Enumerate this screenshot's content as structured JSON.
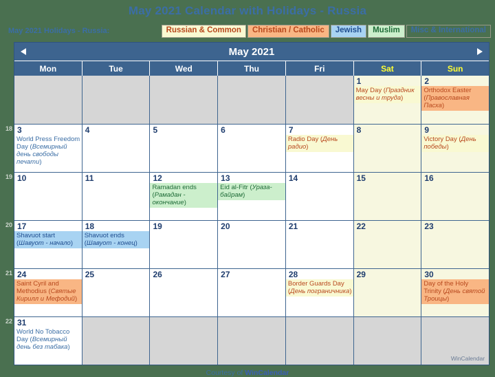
{
  "banner": {
    "title": "May 2021 Calendar with Holidays - Russia"
  },
  "legend": {
    "caption": "May 2021 Holidays - Russia:",
    "chips": [
      {
        "label": "Russian & Common",
        "bg": "#f9f9d2",
        "fg": "#b8481d"
      },
      {
        "label": "Christian / Catholic",
        "bg": "#f9b684",
        "fg": "#b8481d"
      },
      {
        "label": "Jewish",
        "bg": "#a8d3f2",
        "fg": "#1f4d8f"
      },
      {
        "label": "Muslim",
        "bg": "#ccefcc",
        "fg": "#1e6b37"
      },
      {
        "label": "Misc & International",
        "bg": "#4a7050",
        "fg": "#3b6ea5"
      }
    ]
  },
  "calendar": {
    "month_title": "May 2021",
    "prev_label": "◀",
    "next_label": "▶",
    "dow": [
      "Mon",
      "Tue",
      "Wed",
      "Thu",
      "Fri",
      "Sat",
      "Sun"
    ],
    "week_numbers": [
      "",
      "18",
      "19",
      "20",
      "21",
      "22"
    ],
    "weeks": [
      [
        {
          "num": "",
          "blank": true
        },
        {
          "num": "",
          "blank": true
        },
        {
          "num": "",
          "blank": true
        },
        {
          "num": "",
          "blank": true
        },
        {
          "num": "",
          "blank": true
        },
        {
          "num": "1",
          "weekend": true,
          "events": [
            {
              "cat": "russian",
              "en": "May Day (",
              "ru": "Праздник весны и труда",
              "close": ")"
            }
          ]
        },
        {
          "num": "2",
          "weekend": true,
          "events": [
            {
              "cat": "christian",
              "en": "Orthodox Easter (",
              "ru": "Православная Пасха",
              "close": ")"
            }
          ]
        }
      ],
      [
        {
          "num": "3",
          "events": [
            {
              "cat": "misc",
              "en": "World Press Freedom Day (",
              "ru": "Всемирный день свободы печати",
              "close": ")"
            }
          ]
        },
        {
          "num": "4",
          "events": []
        },
        {
          "num": "5",
          "events": []
        },
        {
          "num": "6",
          "events": []
        },
        {
          "num": "7",
          "events": [
            {
              "cat": "russian",
              "en": "Radio Day (",
              "ru": "День радио",
              "close": ")"
            }
          ]
        },
        {
          "num": "8",
          "weekend": true,
          "events": []
        },
        {
          "num": "9",
          "weekend": true,
          "events": [
            {
              "cat": "russian",
              "en": "Victory Day (",
              "ru": "День победы",
              "close": ")"
            }
          ]
        }
      ],
      [
        {
          "num": "10",
          "events": []
        },
        {
          "num": "11",
          "events": []
        },
        {
          "num": "12",
          "events": [
            {
              "cat": "muslim",
              "en": "Ramadan ends (",
              "ru": "Рамадан - окончание",
              "close": ")"
            }
          ]
        },
        {
          "num": "13",
          "events": [
            {
              "cat": "muslim",
              "en": "Eid al-Fitr (",
              "ru": "Ураза-байрам",
              "close": ")"
            }
          ]
        },
        {
          "num": "14",
          "events": []
        },
        {
          "num": "15",
          "weekend": true,
          "events": []
        },
        {
          "num": "16",
          "weekend": true,
          "events": []
        }
      ],
      [
        {
          "num": "17",
          "events": [
            {
              "cat": "jewish",
              "en": "Shavuot start (",
              "ru": "Шавуот - начало",
              "close": ")"
            }
          ]
        },
        {
          "num": "18",
          "events": [
            {
              "cat": "jewish",
              "en": "Shavuot ends (",
              "ru": "Шавуот - конец",
              "close": ")"
            }
          ]
        },
        {
          "num": "19",
          "events": []
        },
        {
          "num": "20",
          "events": []
        },
        {
          "num": "21",
          "events": []
        },
        {
          "num": "22",
          "weekend": true,
          "events": []
        },
        {
          "num": "23",
          "weekend": true,
          "events": []
        }
      ],
      [
        {
          "num": "24",
          "events": [
            {
              "cat": "christian",
              "en": "Saint Cyril and Methodius (",
              "ru": "Святые Кирилл и Мефодий",
              "close": ")"
            }
          ]
        },
        {
          "num": "25",
          "events": []
        },
        {
          "num": "26",
          "events": []
        },
        {
          "num": "27",
          "events": []
        },
        {
          "num": "28",
          "events": [
            {
              "cat": "russian",
              "en": "Border Guards Day (",
              "ru": "День пограничника",
              "close": ")"
            }
          ]
        },
        {
          "num": "29",
          "weekend": true,
          "events": []
        },
        {
          "num": "30",
          "weekend": true,
          "events": [
            {
              "cat": "christian",
              "en": "Day of the Holy Trinity (",
              "ru": "День святой Троицы",
              "close": ")"
            }
          ]
        }
      ],
      [
        {
          "num": "31",
          "events": [
            {
              "cat": "misc",
              "en": "World No Tobacco Day (",
              "ru": "Всемирный день без табака",
              "close": ")"
            }
          ]
        },
        {
          "num": "",
          "blank": true
        },
        {
          "num": "",
          "blank": true
        },
        {
          "num": "",
          "blank": true
        },
        {
          "num": "",
          "blank": true
        },
        {
          "num": "",
          "blank": true
        },
        {
          "num": "",
          "blank": true,
          "watermark": "WinCalendar"
        }
      ]
    ]
  },
  "footer": {
    "prefix": "Courtesy of ",
    "brand": "WinCalendar"
  }
}
